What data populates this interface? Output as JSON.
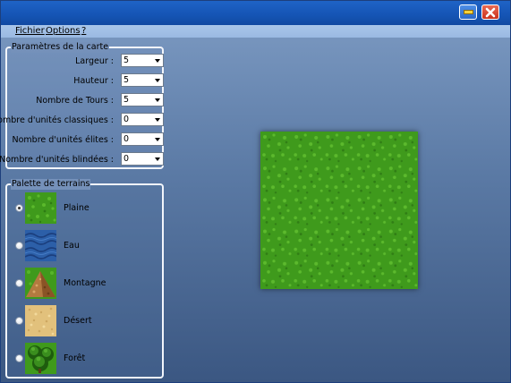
{
  "window": {
    "minimize_icon": "minimize-icon",
    "close_icon": "close-x-icon"
  },
  "menu": {
    "items": [
      "Fichier",
      "Options",
      "?"
    ]
  },
  "map_params": {
    "legend": "Paramètres de la carte",
    "rows": [
      {
        "label": "Largeur :",
        "value": "5"
      },
      {
        "label": "Hauteur :",
        "value": "5"
      },
      {
        "label": "Nombre de Tours :",
        "value": "5"
      },
      {
        "label": "Nombre d'unités classiques :",
        "value": "0"
      },
      {
        "label": "Nombre d'unités élites :",
        "value": "0"
      },
      {
        "label": "Nombre d'unités blindées :",
        "value": "0"
      }
    ]
  },
  "palette": {
    "legend": "Palette de terrains",
    "selected": "Plaine",
    "items": [
      {
        "label": "Plaine",
        "icon": "grass-tile-icon"
      },
      {
        "label": "Eau",
        "icon": "water-tile-icon"
      },
      {
        "label": "Montagne",
        "icon": "mountain-tile-icon"
      },
      {
        "label": "Désert",
        "icon": "desert-tile-icon"
      },
      {
        "label": "Forêt",
        "icon": "forest-tile-icon"
      }
    ]
  },
  "map": {
    "terrain": "Plaine",
    "columns": 5,
    "rows": 5
  },
  "colors": {
    "titlebar": "#1554b4",
    "grass": "#3f9a1c",
    "water": "#2c5fa8",
    "desert": "#e2c17c",
    "forest": "#2e7a18",
    "mountain": "#a8703a"
  }
}
